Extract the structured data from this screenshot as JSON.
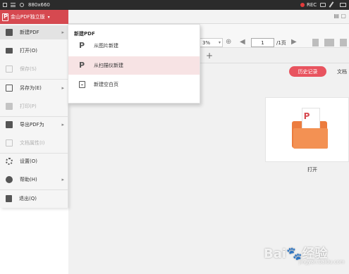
{
  "recorder": {
    "size": "880x660",
    "rec_label": "REC"
  },
  "app": {
    "title": "金山PDF独立版",
    "caret": "▾",
    "brand_color": "#d64950"
  },
  "toolbar": {
    "zoom_value": "3%",
    "page_input": "1",
    "page_total": "/1页",
    "tab_add": "+"
  },
  "main_menu": {
    "items": [
      {
        "label": "新建PDF",
        "icon": "new-pdf-icon",
        "has_submenu": true,
        "active": true,
        "disabled": false
      },
      {
        "label": "打开(O)",
        "icon": "open-folder-icon",
        "has_submenu": false,
        "active": false,
        "disabled": false
      },
      {
        "label": "保存(S)",
        "icon": "save-icon",
        "has_submenu": false,
        "active": false,
        "disabled": true
      },
      {
        "label": "另存为(E)",
        "icon": "save-as-icon",
        "has_submenu": true,
        "active": false,
        "disabled": false
      },
      {
        "label": "打印(P)",
        "icon": "print-icon",
        "has_submenu": false,
        "active": false,
        "disabled": true
      },
      {
        "label": "导出PDF为",
        "icon": "export-icon",
        "has_submenu": true,
        "active": false,
        "disabled": false
      },
      {
        "label": "文档属性(I)",
        "icon": "properties-icon",
        "has_submenu": false,
        "active": false,
        "disabled": true
      },
      {
        "label": "设置(O)",
        "icon": "settings-icon",
        "has_submenu": false,
        "active": false,
        "disabled": false
      },
      {
        "label": "帮助(H)",
        "icon": "help-icon",
        "has_submenu": true,
        "active": false,
        "disabled": false
      },
      {
        "label": "退出(Q)",
        "icon": "exit-icon",
        "has_submenu": false,
        "active": false,
        "disabled": false
      }
    ]
  },
  "submenu": {
    "heading": "新建PDF",
    "items": [
      {
        "label": "从图片新建",
        "icon": "pdf-from-image-icon"
      },
      {
        "label": "从扫描仪新建",
        "icon": "pdf-from-scanner-icon",
        "highlighted": true
      },
      {
        "label": "新建空白页",
        "icon": "blank-page-icon"
      }
    ]
  },
  "home": {
    "history_button": "历史记录",
    "doc_library": "文档",
    "open_label": "打开",
    "accent_color": "#e8545f",
    "folder_color": "#ec7c3e"
  },
  "watermark": {
    "text": "Bai🐾经验",
    "url": "jingyan.baidu.com"
  }
}
